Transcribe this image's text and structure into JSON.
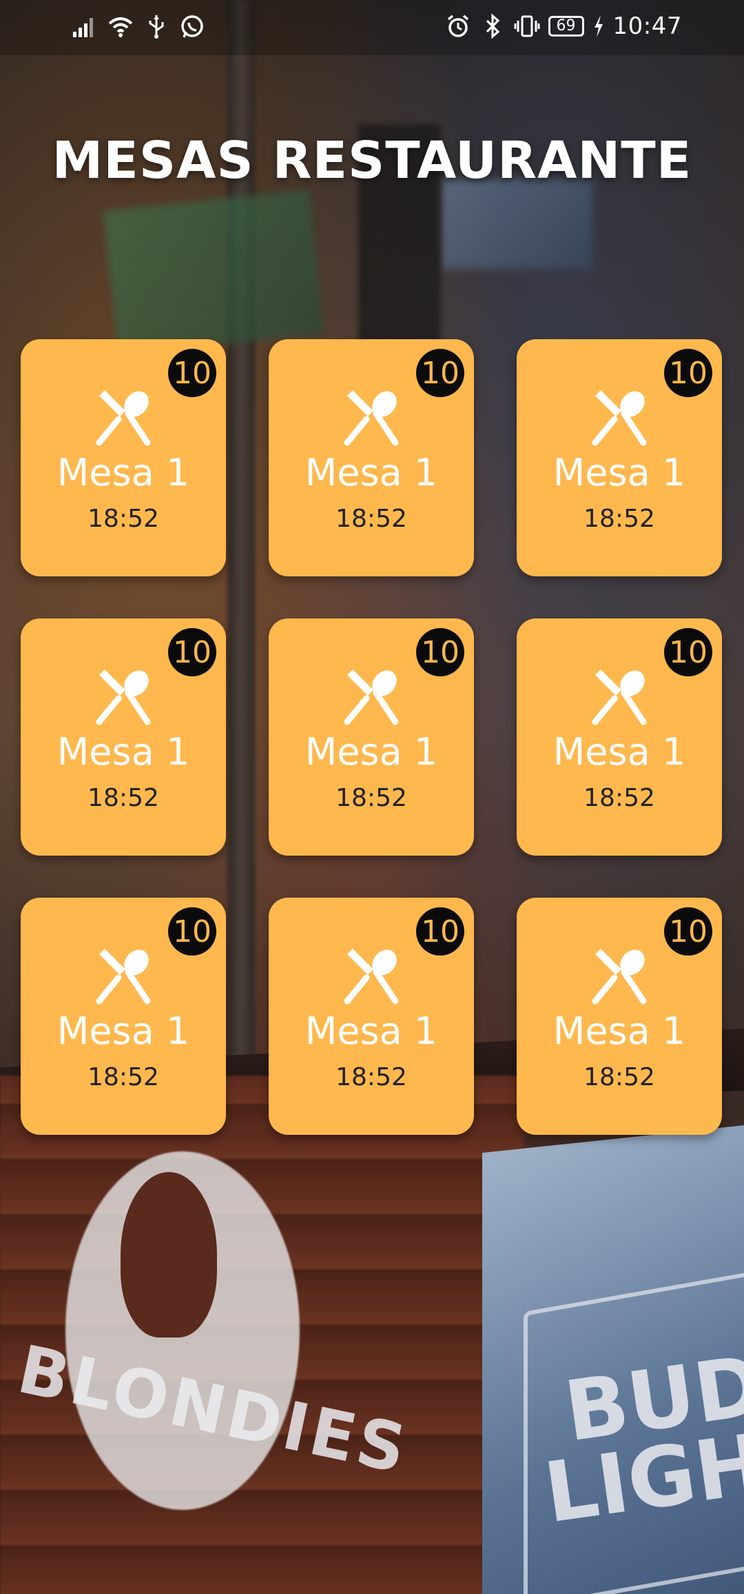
{
  "status_bar": {
    "left_icons": [
      "signal-icon",
      "wifi-icon",
      "usb-icon",
      "whatsapp-icon"
    ],
    "right_icons": [
      "alarm-icon",
      "bluetooth-icon",
      "vibrate-icon",
      "battery-icon",
      "charging-icon"
    ],
    "battery_level": "69",
    "time": "10:47"
  },
  "header": {
    "title": "MESAS RESTAURANTE"
  },
  "tables": [
    {
      "name": "Mesa 1",
      "time": "18:52",
      "badge": "10"
    },
    {
      "name": "Mesa 1",
      "time": "18:52",
      "badge": "10"
    },
    {
      "name": "Mesa 1",
      "time": "18:52",
      "badge": "10"
    },
    {
      "name": "Mesa 1",
      "time": "18:52",
      "badge": "10"
    },
    {
      "name": "Mesa 1",
      "time": "18:52",
      "badge": "10"
    },
    {
      "name": "Mesa 1",
      "time": "18:52",
      "badge": "10"
    },
    {
      "name": "Mesa 1",
      "time": "18:52",
      "badge": "10"
    },
    {
      "name": "Mesa 1",
      "time": "18:52",
      "badge": "10"
    },
    {
      "name": "Mesa 1",
      "time": "18:52",
      "badge": "10"
    }
  ],
  "background_signs": {
    "logo_text": "BLONDIES",
    "sign_line1": "BUD",
    "sign_line2": "LIGHT"
  },
  "colors": {
    "card_background": "#ffb84d",
    "badge_background": "#0b0b0b",
    "badge_text": "#ffb84d",
    "time_text": "#222222",
    "title_text": "#ffffff"
  }
}
